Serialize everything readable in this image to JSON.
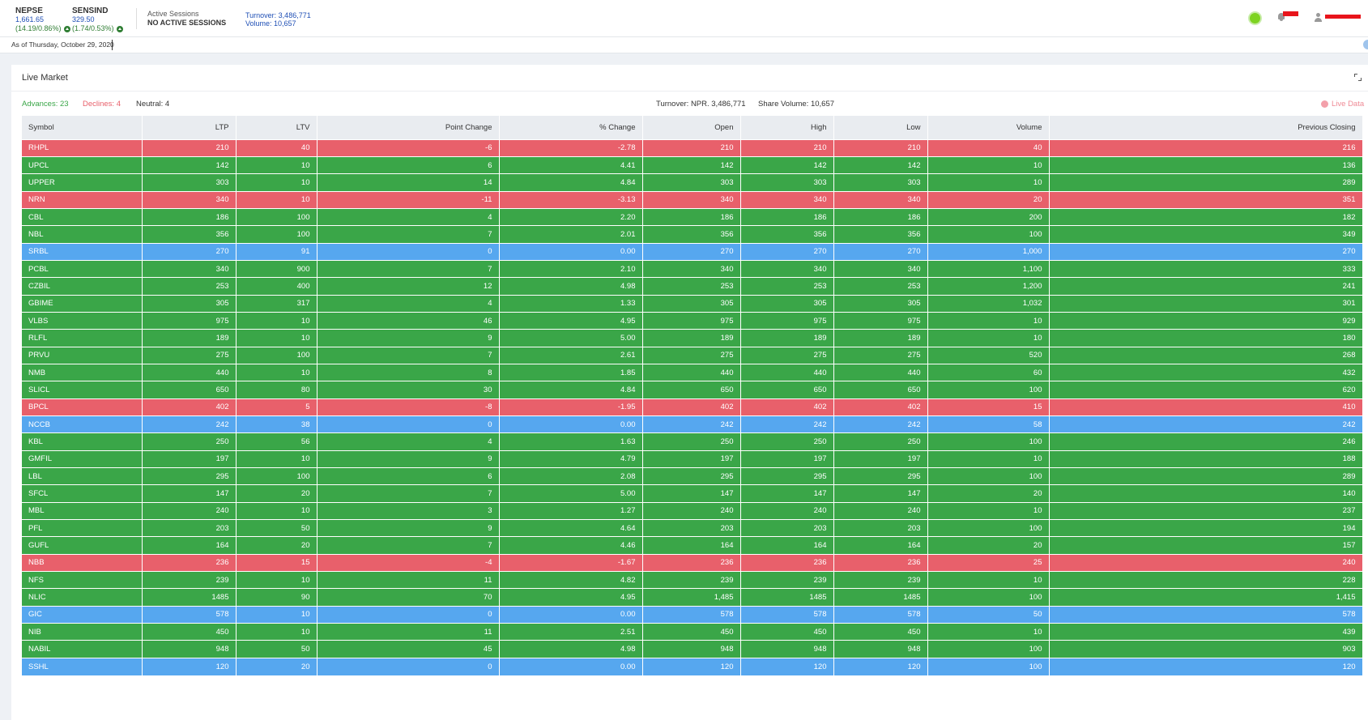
{
  "header": {
    "nepse": {
      "name": "NEPSE",
      "value": "1,661.65",
      "change": "(14.19/0.86%)"
    },
    "sensind": {
      "name": "SENSIND",
      "value": "329.50",
      "change": "(1.74/0.53%)"
    },
    "sessions_label": "Active Sessions",
    "sessions_status": "NO ACTIVE SESSIONS",
    "turnover": "Turnover: 3,486,771",
    "volume": "Volume: 10,657"
  },
  "date_text": "As of Thursday, October 29, 2020",
  "card": {
    "title": "Live Market",
    "advances": "Advances:  23",
    "declines": "Declines:  4",
    "neutral": "Neutral:  4",
    "turnover": "Turnover:  NPR. 3,486,771",
    "share_volume": "Share Volume:  10,657",
    "live": "Live Data"
  },
  "colors": {
    "advance": "#3aa648",
    "decline": "#e8606b",
    "neutral": "#56a7ef"
  },
  "table": {
    "headers": [
      "Symbol",
      "LTP",
      "LTV",
      "Point Change",
      "% Change",
      "Open",
      "High",
      "Low",
      "Volume",
      "Previous Closing"
    ],
    "rows": [
      [
        "RHPL",
        "210",
        "40",
        "-6",
        "-2.78",
        "210",
        "210",
        "210",
        "40",
        "216",
        "r"
      ],
      [
        "UPCL",
        "142",
        "10",
        "6",
        "4.41",
        "142",
        "142",
        "142",
        "10",
        "136",
        "g"
      ],
      [
        "UPPER",
        "303",
        "10",
        "14",
        "4.84",
        "303",
        "303",
        "303",
        "10",
        "289",
        "g"
      ],
      [
        "NRN",
        "340",
        "10",
        "-11",
        "-3.13",
        "340",
        "340",
        "340",
        "20",
        "351",
        "r"
      ],
      [
        "CBL",
        "186",
        "100",
        "4",
        "2.20",
        "186",
        "186",
        "186",
        "200",
        "182",
        "g"
      ],
      [
        "NBL",
        "356",
        "100",
        "7",
        "2.01",
        "356",
        "356",
        "356",
        "100",
        "349",
        "g"
      ],
      [
        "SRBL",
        "270",
        "91",
        "0",
        "0.00",
        "270",
        "270",
        "270",
        "1,000",
        "270",
        "b"
      ],
      [
        "PCBL",
        "340",
        "900",
        "7",
        "2.10",
        "340",
        "340",
        "340",
        "1,100",
        "333",
        "g"
      ],
      [
        "CZBIL",
        "253",
        "400",
        "12",
        "4.98",
        "253",
        "253",
        "253",
        "1,200",
        "241",
        "g"
      ],
      [
        "GBIME",
        "305",
        "317",
        "4",
        "1.33",
        "305",
        "305",
        "305",
        "1,032",
        "301",
        "g"
      ],
      [
        "VLBS",
        "975",
        "10",
        "46",
        "4.95",
        "975",
        "975",
        "975",
        "10",
        "929",
        "g"
      ],
      [
        "RLFL",
        "189",
        "10",
        "9",
        "5.00",
        "189",
        "189",
        "189",
        "10",
        "180",
        "g"
      ],
      [
        "PRVU",
        "275",
        "100",
        "7",
        "2.61",
        "275",
        "275",
        "275",
        "520",
        "268",
        "g"
      ],
      [
        "NMB",
        "440",
        "10",
        "8",
        "1.85",
        "440",
        "440",
        "440",
        "60",
        "432",
        "g"
      ],
      [
        "SLICL",
        "650",
        "80",
        "30",
        "4.84",
        "650",
        "650",
        "650",
        "100",
        "620",
        "g"
      ],
      [
        "BPCL",
        "402",
        "5",
        "-8",
        "-1.95",
        "402",
        "402",
        "402",
        "15",
        "410",
        "r"
      ],
      [
        "NCCB",
        "242",
        "38",
        "0",
        "0.00",
        "242",
        "242",
        "242",
        "58",
        "242",
        "b"
      ],
      [
        "KBL",
        "250",
        "56",
        "4",
        "1.63",
        "250",
        "250",
        "250",
        "100",
        "246",
        "g"
      ],
      [
        "GMFIL",
        "197",
        "10",
        "9",
        "4.79",
        "197",
        "197",
        "197",
        "10",
        "188",
        "g"
      ],
      [
        "LBL",
        "295",
        "100",
        "6",
        "2.08",
        "295",
        "295",
        "295",
        "100",
        "289",
        "g"
      ],
      [
        "SFCL",
        "147",
        "20",
        "7",
        "5.00",
        "147",
        "147",
        "147",
        "20",
        "140",
        "g"
      ],
      [
        "MBL",
        "240",
        "10",
        "3",
        "1.27",
        "240",
        "240",
        "240",
        "10",
        "237",
        "g"
      ],
      [
        "PFL",
        "203",
        "50",
        "9",
        "4.64",
        "203",
        "203",
        "203",
        "100",
        "194",
        "g"
      ],
      [
        "GUFL",
        "164",
        "20",
        "7",
        "4.46",
        "164",
        "164",
        "164",
        "20",
        "157",
        "g"
      ],
      [
        "NBB",
        "236",
        "15",
        "-4",
        "-1.67",
        "236",
        "236",
        "236",
        "25",
        "240",
        "r"
      ],
      [
        "NFS",
        "239",
        "10",
        "11",
        "4.82",
        "239",
        "239",
        "239",
        "10",
        "228",
        "g"
      ],
      [
        "NLIC",
        "1485",
        "90",
        "70",
        "4.95",
        "1,485",
        "1485",
        "1485",
        "100",
        "1,415",
        "g"
      ],
      [
        "GIC",
        "578",
        "10",
        "0",
        "0.00",
        "578",
        "578",
        "578",
        "50",
        "578",
        "b"
      ],
      [
        "NIB",
        "450",
        "10",
        "11",
        "2.51",
        "450",
        "450",
        "450",
        "10",
        "439",
        "g"
      ],
      [
        "NABIL",
        "948",
        "50",
        "45",
        "4.98",
        "948",
        "948",
        "948",
        "100",
        "903",
        "g"
      ],
      [
        "SSHL",
        "120",
        "20",
        "0",
        "0.00",
        "120",
        "120",
        "120",
        "100",
        "120",
        "b"
      ]
    ]
  }
}
